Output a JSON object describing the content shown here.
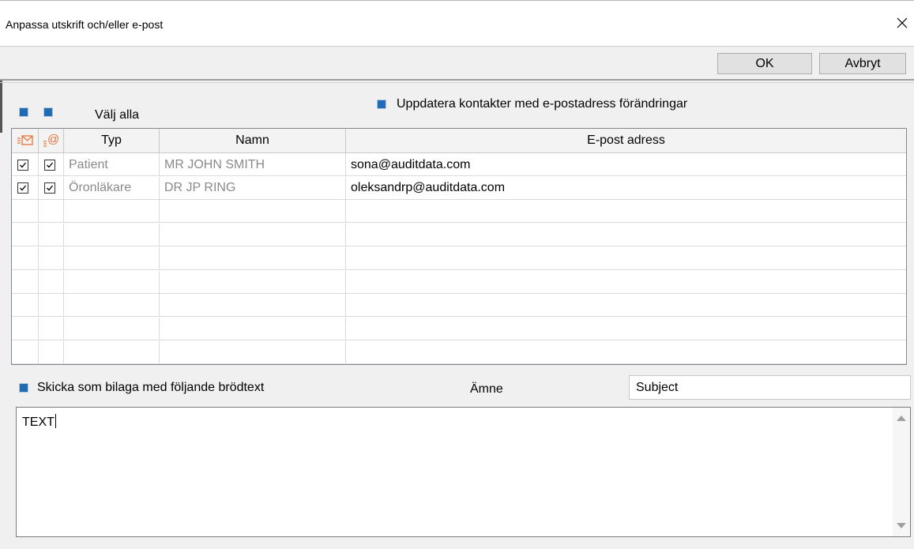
{
  "window": {
    "title": "Anpassa utskrift och/eller e-post"
  },
  "toolbar": {
    "ok_label": "OK",
    "cancel_label": "Avbryt"
  },
  "select_all": {
    "label": "Välj alla"
  },
  "update_contacts": {
    "label": "Uppdatera kontakter med e-postadress förändringar"
  },
  "grid": {
    "headers": {
      "col_print": "print-mail-icon",
      "col_email": "email-at-icon",
      "typ": "Typ",
      "namn": "Namn",
      "email": "E-post adress"
    },
    "rows": [
      {
        "print_checked": true,
        "email_checked": true,
        "typ": "Patient",
        "namn": "MR JOHN SMITH",
        "email": "sona@auditdata.com"
      },
      {
        "print_checked": true,
        "email_checked": true,
        "typ": "Öronläkare",
        "namn": "DR JP RING",
        "email": "oleksandrp@auditdata.com"
      }
    ],
    "empty_rows": 7
  },
  "attachment": {
    "label": "Skicka som bilaga med följande brödtext"
  },
  "subject": {
    "label": "Ämne",
    "value": "Subject"
  },
  "body": {
    "text": "TEXT"
  },
  "colors": {
    "accent": "#1f6bb4",
    "icon_orange": "#e8733a",
    "muted_text": "#8a8a8a"
  }
}
